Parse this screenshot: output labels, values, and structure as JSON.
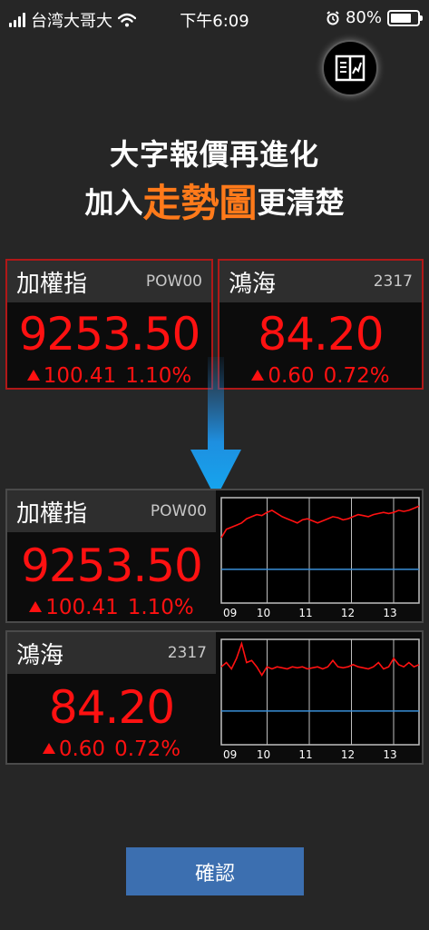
{
  "status_bar": {
    "carrier": "台湾大哥大",
    "time": "下午6:09",
    "battery": "80%",
    "battery_level": 0.8
  },
  "corner_button": {
    "icon": "chart-book-icon"
  },
  "headline": {
    "line1": "大字報價再進化",
    "line2_prefix": "加入",
    "line2_accent": "走勢圖",
    "line2_suffix": "更清楚",
    "accent_color": "#ff7a1a"
  },
  "old_cards": [
    {
      "name": "加權指",
      "code": "POW00",
      "price": "9253.50",
      "change": "100.41",
      "percent": "1.10%"
    },
    {
      "name": "鴻海",
      "code": "2317",
      "price": "84.20",
      "change": "0.60",
      "percent": "0.72%"
    }
  ],
  "new_cards": [
    {
      "name": "加權指",
      "code": "POW00",
      "price": "9253.50",
      "change": "100.41",
      "percent": "1.10%"
    },
    {
      "name": "鴻海",
      "code": "2317",
      "price": "84.20",
      "change": "0.60",
      "percent": "0.72%"
    }
  ],
  "colors": {
    "up": "#ff1111",
    "reference_line": "#3a8fd8",
    "confirm": "#3c6fb0"
  },
  "chart_data": [
    {
      "type": "line",
      "x_ticks": [
        "09",
        "10",
        "11",
        "12",
        "13"
      ],
      "series": [
        {
          "values": [
            0.62,
            0.7,
            0.72,
            0.74,
            0.76,
            0.8,
            0.82,
            0.84,
            0.83,
            0.86,
            0.88,
            0.85,
            0.82,
            0.8,
            0.78,
            0.76,
            0.79,
            0.8,
            0.78,
            0.76,
            0.78,
            0.8,
            0.82,
            0.81,
            0.79,
            0.8,
            0.82,
            0.84,
            0.83,
            0.82,
            0.84,
            0.85,
            0.86,
            0.85,
            0.86,
            0.88,
            0.87,
            0.88,
            0.9,
            0.92
          ]
        }
      ],
      "reference": 0.32,
      "ylim": [
        0,
        1
      ]
    },
    {
      "type": "line",
      "x_ticks": [
        "09",
        "10",
        "11",
        "12",
        "13"
      ],
      "series": [
        {
          "values": [
            0.74,
            0.78,
            0.72,
            0.82,
            0.96,
            0.78,
            0.8,
            0.74,
            0.66,
            0.74,
            0.72,
            0.74,
            0.73,
            0.72,
            0.74,
            0.73,
            0.74,
            0.72,
            0.73,
            0.74,
            0.72,
            0.74,
            0.8,
            0.74,
            0.73,
            0.74,
            0.76,
            0.74,
            0.73,
            0.72,
            0.74,
            0.78,
            0.72,
            0.74,
            0.82,
            0.76,
            0.74,
            0.78,
            0.74,
            0.76
          ]
        }
      ],
      "reference": 0.32,
      "ylim": [
        0,
        1
      ]
    }
  ],
  "confirm_label": "確認"
}
